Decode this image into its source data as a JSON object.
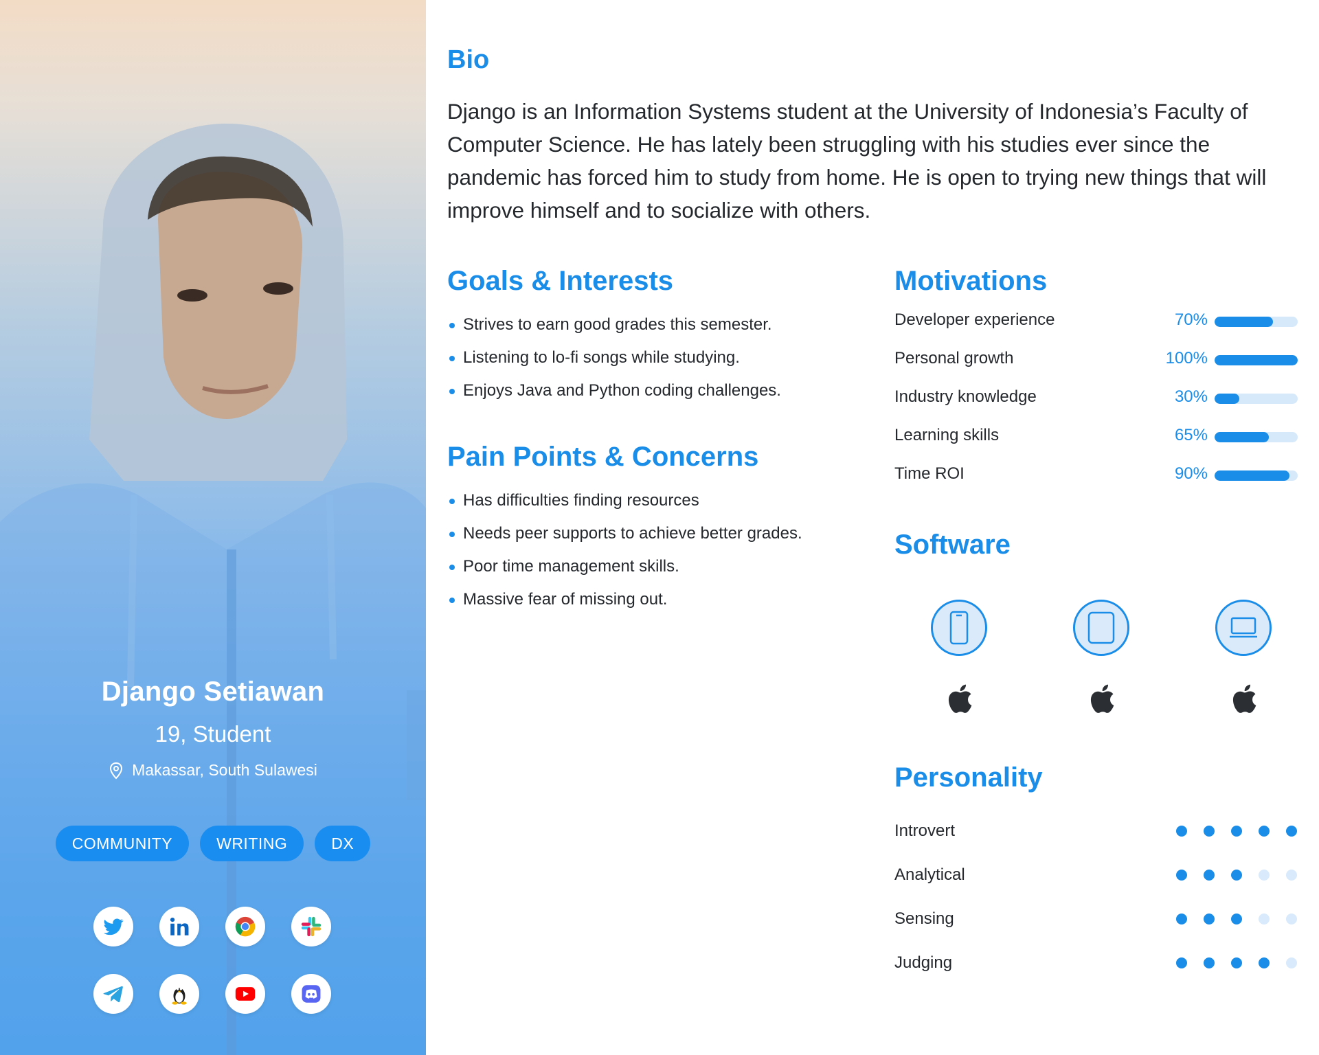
{
  "profile": {
    "name": "Django Setiawan",
    "role": "19, Student",
    "location": "Makassar, South Sulawesi",
    "tags": [
      "COMMUNITY",
      "WRITING",
      "DX"
    ],
    "socials": [
      "twitter-icon",
      "linkedin-icon",
      "chrome-icon",
      "slack-icon",
      "telegram-icon",
      "linux-icon",
      "youtube-icon",
      "discord-icon"
    ]
  },
  "bio": {
    "title": "Bio",
    "text": "Django is an Information Systems student at the University of Indonesia’s Faculty of Computer Science. He has lately been struggling with his studies ever since the pandemic has forced him to study from home. He is open to trying new things that will improve himself and to socialize with others."
  },
  "goals": {
    "title": "Goals & Interests",
    "items": [
      "Strives to earn good grades this semester.",
      "Listening to lo-fi songs while studying.",
      "Enjoys Java and Python coding challenges."
    ]
  },
  "pain_points": {
    "title": "Pain Points & Concerns",
    "items": [
      "Has difficulties finding resources",
      "Needs peer supports to achieve better grades.",
      "Poor time management skills.",
      "Massive fear of missing out."
    ]
  },
  "motivations": {
    "title": "Motivations",
    "items": [
      {
        "label": "Developer experience",
        "pct": "70%",
        "value": 0.7
      },
      {
        "label": "Personal growth",
        "pct": "100%",
        "value": 1.0
      },
      {
        "label": "Industry knowledge",
        "pct": "30%",
        "value": 0.3
      },
      {
        "label": "Learning skills",
        "pct": "65%",
        "value": 0.65
      },
      {
        "label": "Time ROI",
        "pct": "90%",
        "value": 0.9
      }
    ]
  },
  "software": {
    "title": "Software",
    "devices": [
      "phone-icon",
      "tablet-icon",
      "laptop-icon"
    ],
    "platform_icon": "apple-icon"
  },
  "personality": {
    "title": "Personality",
    "items": [
      {
        "label": "Introvert",
        "level": 5
      },
      {
        "label": "Analytical",
        "level": 3
      },
      {
        "label": "Sensing",
        "level": 3
      },
      {
        "label": "Judging",
        "level": 4
      }
    ],
    "max": 5
  },
  "colors": {
    "accent": "#1a8de8",
    "accent_light": "#d6e9fb",
    "text": "#24282d"
  }
}
